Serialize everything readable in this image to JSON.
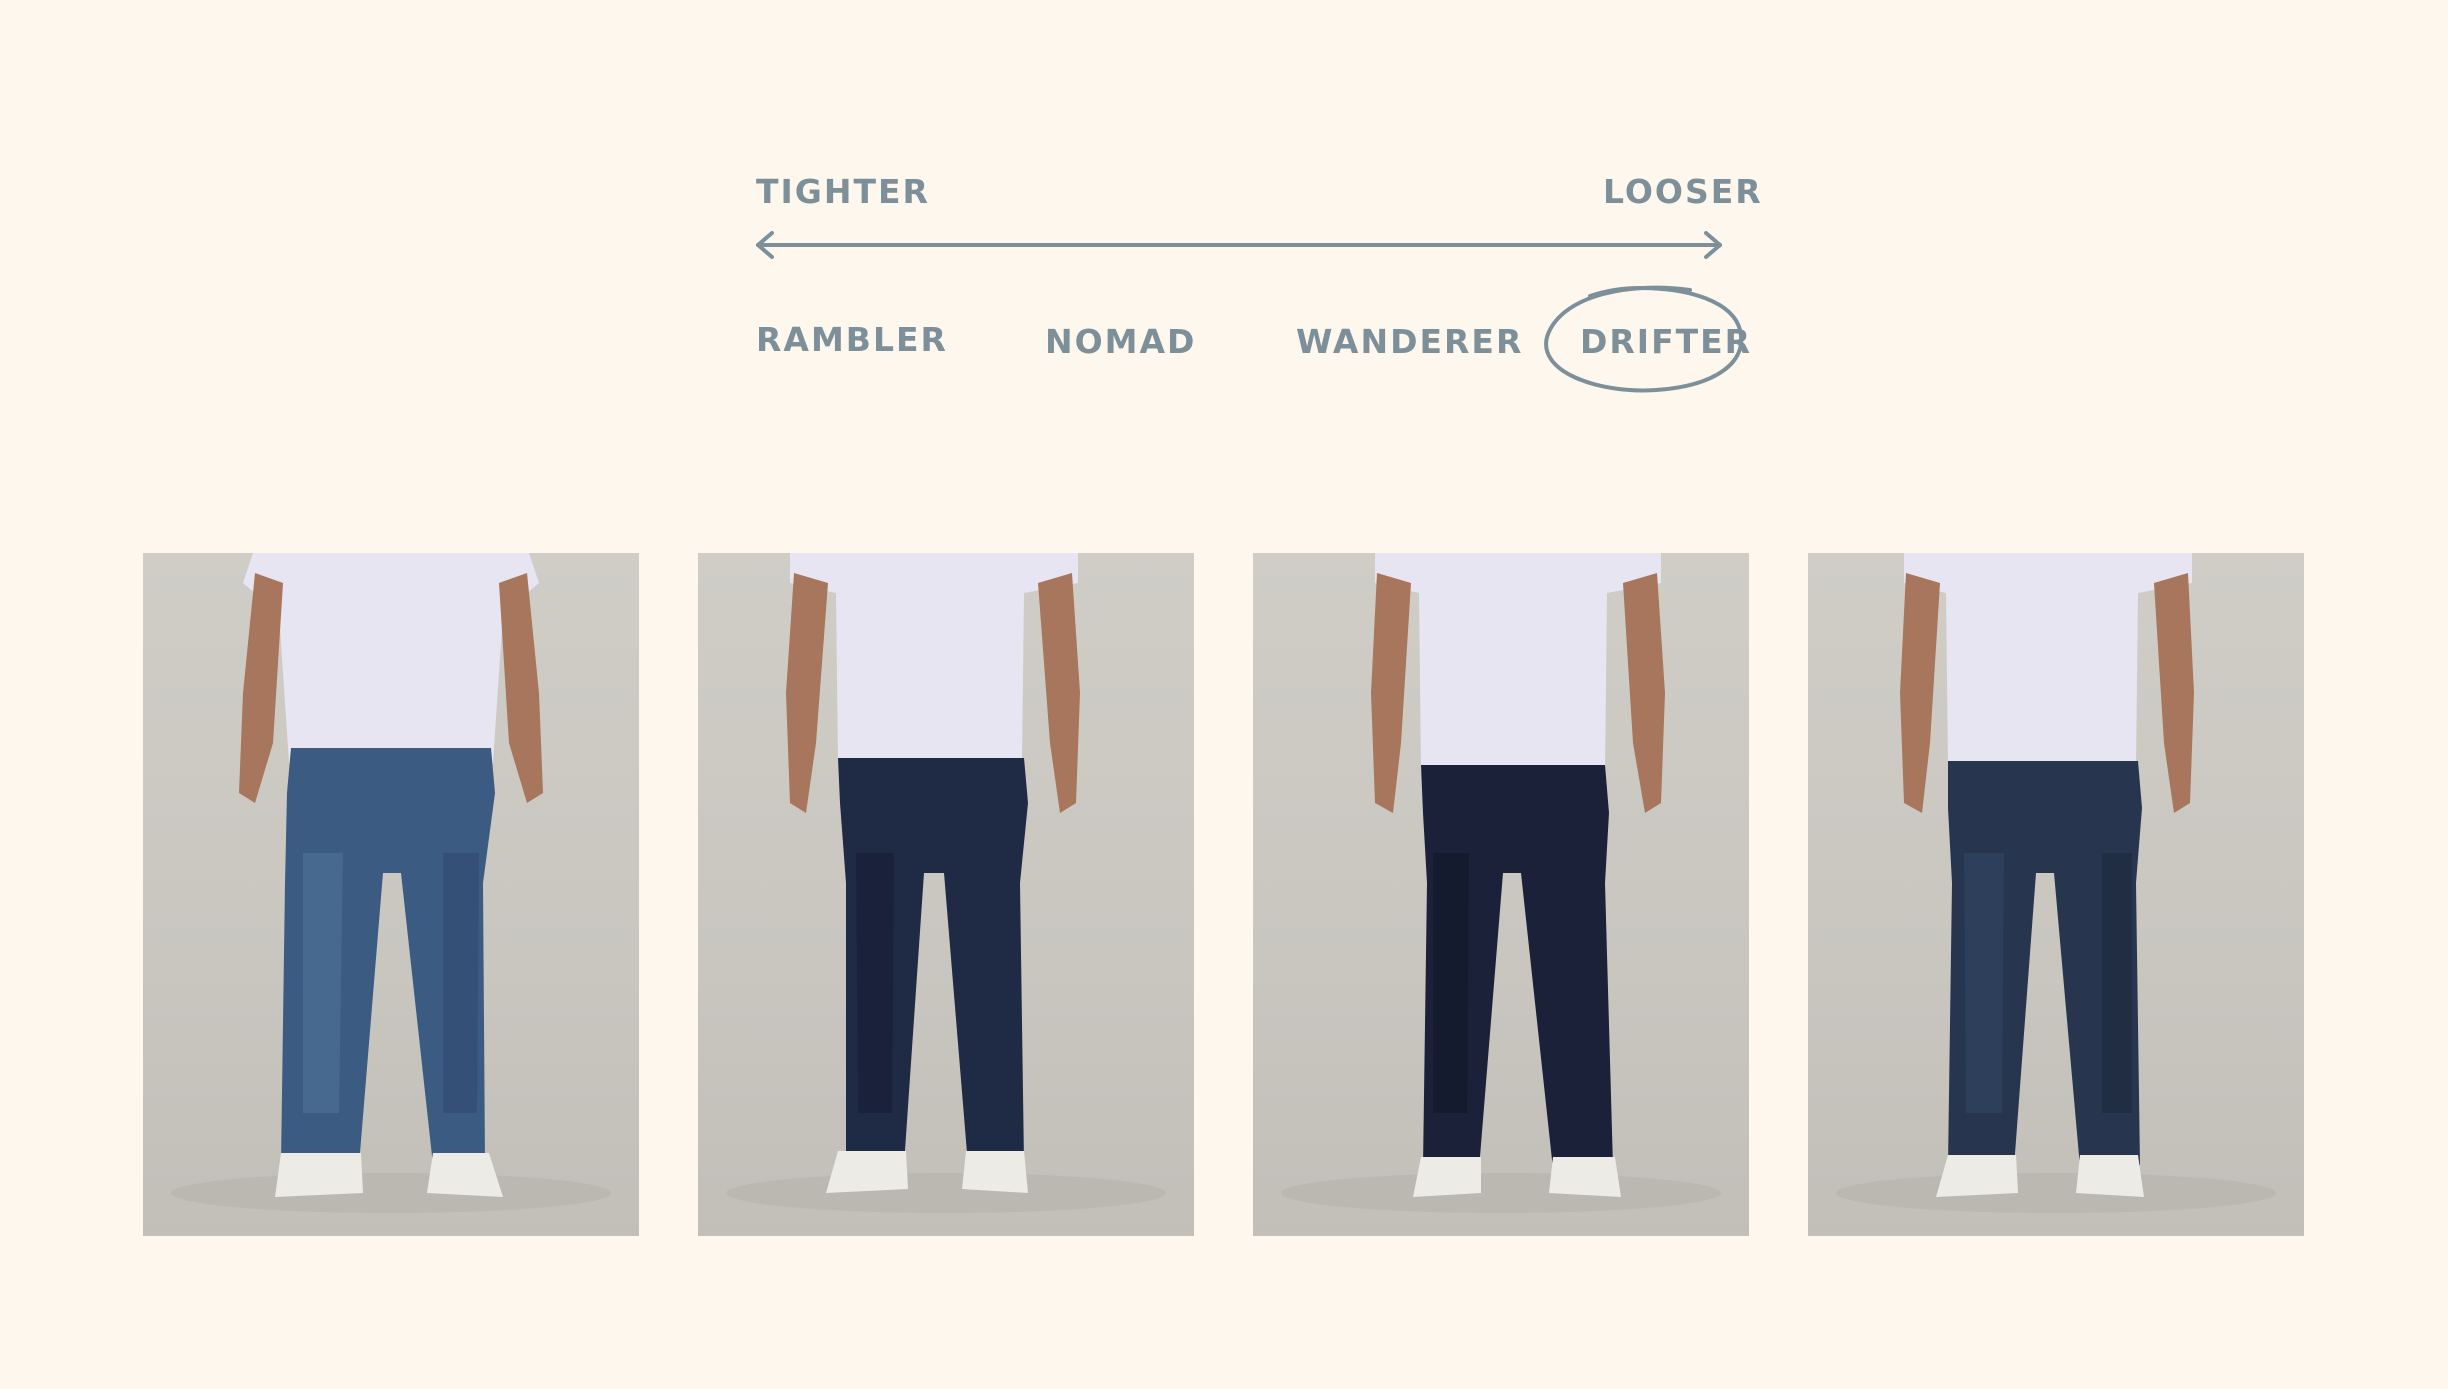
{
  "scale": {
    "left_label": "TIGHTER",
    "right_label": "LOOSER"
  },
  "fits": [
    {
      "label": "RAMBLER",
      "selected": false
    },
    {
      "label": "NOMAD",
      "selected": false
    },
    {
      "label": "WANDERER",
      "selected": false
    },
    {
      "label": "DRIFTER",
      "selected": true
    }
  ],
  "colors": {
    "background": "#fdf7ee",
    "label": "#7d909a",
    "photo_backdrop": "#cbc9c2",
    "shirt": "#e6e5f1",
    "skin": "#a7765c",
    "sneaker": "#ecebe6"
  },
  "photos": [
    {
      "denim_color": "#3c5b82",
      "denim_shade": "#2e4a6e"
    },
    {
      "denim_color": "#1f2a44",
      "denim_shade": "#161e33"
    },
    {
      "denim_color": "#1a2138",
      "denim_shade": "#12182a"
    },
    {
      "denim_color": "#27364e",
      "denim_shade": "#1c283b"
    }
  ]
}
